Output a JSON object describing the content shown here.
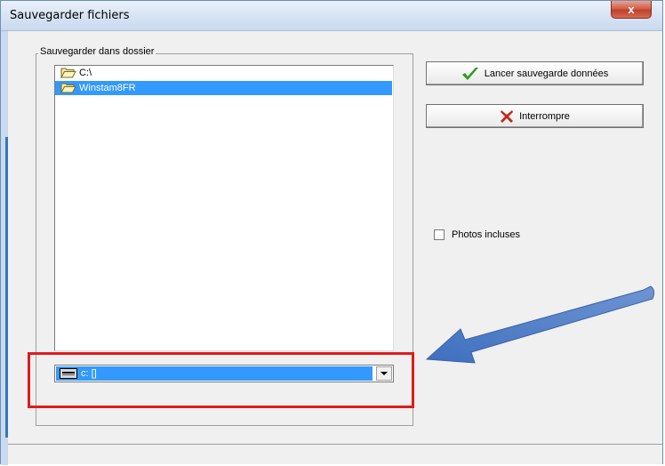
{
  "window": {
    "title": "Sauvegarder fichiers",
    "close_glyph": "x"
  },
  "groupbox": {
    "label": "Sauvegarder dans dossier"
  },
  "directory_list": {
    "items": [
      {
        "label": "C:\\",
        "icon": "folder-open-icon",
        "selected": false
      },
      {
        "label": "Winstam8FR",
        "icon": "folder-open-icon",
        "selected": true
      }
    ]
  },
  "drive_combo": {
    "value": "c: []",
    "icon": "drive-icon"
  },
  "buttons": {
    "start_label": "Lancer sauvegarde données",
    "interrupt_label": "Interrompre"
  },
  "options": {
    "photos_label": "Photos incluses",
    "photos_checked": false
  },
  "colors": {
    "selection": "#3399ff",
    "highlight_box": "#e11b1b",
    "arrow": "#4a78c0",
    "check": "#2e9a1c",
    "cross": "#c0281a"
  }
}
